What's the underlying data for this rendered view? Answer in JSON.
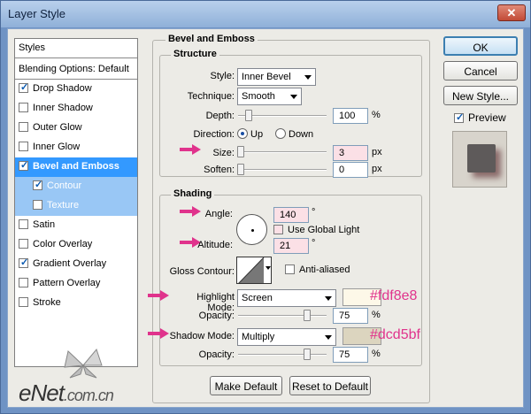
{
  "window": {
    "title": "Layer Style",
    "close_glyph": "✕"
  },
  "styles_panel": {
    "header": "Styles",
    "blending_options": "Blending Options: Default",
    "items": [
      {
        "label": "Drop Shadow",
        "checked": true
      },
      {
        "label": "Inner Shadow",
        "checked": false
      },
      {
        "label": "Outer Glow",
        "checked": false
      },
      {
        "label": "Inner Glow",
        "checked": false
      },
      {
        "label": "Bevel and Emboss",
        "checked": true,
        "selected": true
      },
      {
        "label": "Contour",
        "checked": true,
        "sub": true
      },
      {
        "label": "Texture",
        "checked": false,
        "sub": true
      },
      {
        "label": "Satin",
        "checked": false
      },
      {
        "label": "Color Overlay",
        "checked": false
      },
      {
        "label": "Gradient Overlay",
        "checked": true
      },
      {
        "label": "Pattern Overlay",
        "checked": false
      },
      {
        "label": "Stroke",
        "checked": false
      }
    ]
  },
  "bevel": {
    "title": "Bevel and Emboss",
    "structure": {
      "title": "Structure",
      "style_label": "Style:",
      "style_value": "Inner Bevel",
      "technique_label": "Technique:",
      "technique_value": "Smooth",
      "depth_label": "Depth:",
      "depth_value": "100",
      "depth_unit": "%",
      "direction_label": "Direction:",
      "direction_up": "Up",
      "direction_down": "Down",
      "size_label": "Size:",
      "size_value": "3",
      "size_unit": "px",
      "soften_label": "Soften:",
      "soften_value": "0",
      "soften_unit": "px"
    },
    "shading": {
      "title": "Shading",
      "angle_label": "Angle:",
      "angle_value": "140",
      "angle_unit": "°",
      "global_light_label": "Use Global Light",
      "altitude_label": "Altitude:",
      "altitude_value": "21",
      "altitude_unit": "°",
      "gloss_label": "Gloss Contour:",
      "anti_aliased_label": "Anti-aliased",
      "highlight_mode_label": "Highlight Mode:",
      "highlight_mode_value": "Screen",
      "highlight_color": "#fdf8e8",
      "highlight_hex_text": "#fdf8e8",
      "highlight_opacity_label": "Opacity:",
      "highlight_opacity_value": "75",
      "highlight_opacity_unit": "%",
      "shadow_mode_label": "Shadow Mode:",
      "shadow_mode_value": "Multiply",
      "shadow_color": "#dcd5bf",
      "shadow_hex_text": "#dcd5bf",
      "shadow_opacity_label": "Opacity:",
      "shadow_opacity_value": "75",
      "shadow_opacity_unit": "%"
    },
    "make_default": "Make Default",
    "reset_default": "Reset to Default"
  },
  "actions": {
    "ok": "OK",
    "cancel": "Cancel",
    "new_style": "New Style...",
    "preview_label": "Preview"
  },
  "watermark": {
    "brand": "eNet",
    "domain": ".com.cn"
  },
  "colors": {
    "annotation_pink": "#e0338c",
    "selection_blue": "#3399ff"
  }
}
